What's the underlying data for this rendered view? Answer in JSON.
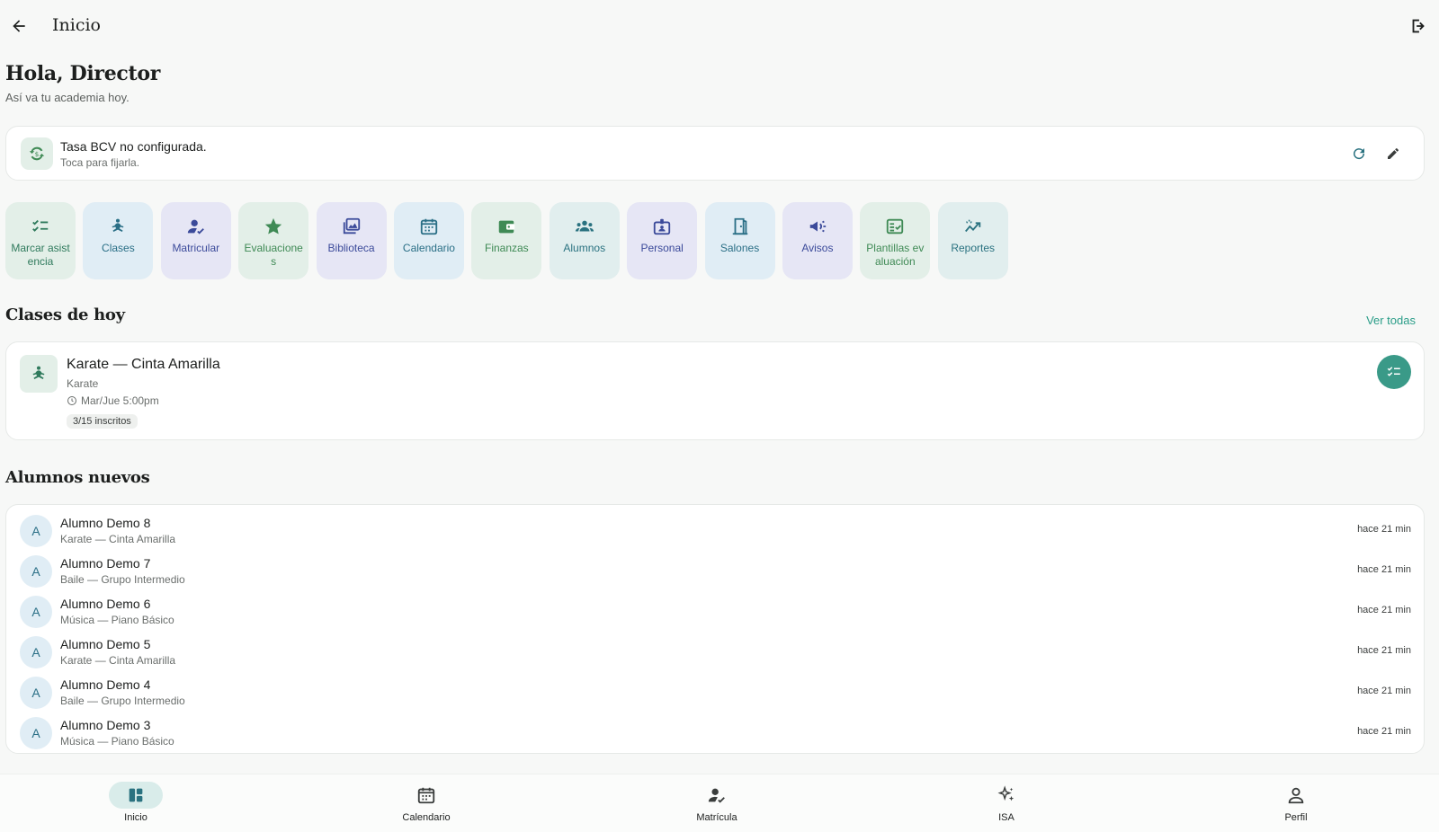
{
  "topbar": {
    "title": "Inicio"
  },
  "greeting": {
    "title": "Hola, Director",
    "subtitle": "Así va tu academia hoy."
  },
  "rate": {
    "title": "Tasa BCV no configurada.",
    "subtitle": "Toca para fijarla."
  },
  "quick_actions": [
    {
      "label": "Marcar asistencia",
      "icon": "checklist-icon",
      "bg": "#e3efe8",
      "color": "#2f7a5c"
    },
    {
      "label": "Clases",
      "icon": "meditation-icon",
      "bg": "#e0edf5",
      "color": "#2a6f86"
    },
    {
      "label": "Matricular",
      "icon": "person-check-icon",
      "bg": "#e6e6f5",
      "color": "#3b4a9a"
    },
    {
      "label": "Evaluaciones",
      "icon": "star-icon",
      "bg": "#e3efe8",
      "color": "#3f8a55"
    },
    {
      "label": "Biblioteca",
      "icon": "photo-library-icon",
      "bg": "#e6e6f5",
      "color": "#3b4a9a"
    },
    {
      "label": "Calendario",
      "icon": "calendar-icon",
      "bg": "#e0edf5",
      "color": "#2a6f86"
    },
    {
      "label": "Finanzas",
      "icon": "wallet-icon",
      "bg": "#e3efe8",
      "color": "#3f8a55"
    },
    {
      "label": "Alumnos",
      "icon": "groups-icon",
      "bg": "#e1eeee",
      "color": "#2a7280"
    },
    {
      "label": "Personal",
      "icon": "badge-icon",
      "bg": "#e6e6f5",
      "color": "#3b4a9a"
    },
    {
      "label": "Salones",
      "icon": "door-icon",
      "bg": "#e0edf5",
      "color": "#2a6f86"
    },
    {
      "label": "Avisos",
      "icon": "megaphone-icon",
      "bg": "#e6e6f5",
      "color": "#3b4a9a"
    },
    {
      "label": "Plantillas evaluación",
      "icon": "fact-check-icon",
      "bg": "#e3efe8",
      "color": "#3f8a55"
    },
    {
      "label": "Reportes",
      "icon": "trending-icon",
      "bg": "#e1eeee",
      "color": "#2a7280"
    }
  ],
  "classes_today": {
    "title": "Clases de hoy",
    "see_all": "Ver todas",
    "items": [
      {
        "name": "Karate — Cinta Amarilla",
        "discipline": "Karate",
        "schedule": "Mar/Jue 5:00pm",
        "enrolled": "3/15 inscritos"
      }
    ]
  },
  "new_students": {
    "title": "Alumnos nuevos",
    "items": [
      {
        "initial": "A",
        "name": "Alumno Demo 8",
        "class": "Karate — Cinta Amarilla",
        "time": "hace 21 min"
      },
      {
        "initial": "A",
        "name": "Alumno Demo 7",
        "class": "Baile — Grupo Intermedio",
        "time": "hace 21 min"
      },
      {
        "initial": "A",
        "name": "Alumno Demo 6",
        "class": "Música — Piano Básico",
        "time": "hace 21 min"
      },
      {
        "initial": "A",
        "name": "Alumno Demo 5",
        "class": "Karate — Cinta Amarilla",
        "time": "hace 21 min"
      },
      {
        "initial": "A",
        "name": "Alumno Demo 4",
        "class": "Baile — Grupo Intermedio",
        "time": "hace 21 min"
      },
      {
        "initial": "A",
        "name": "Alumno Demo 3",
        "class": "Música — Piano Básico",
        "time": "hace 21 min"
      }
    ]
  },
  "bottom_nav": [
    {
      "label": "Inicio",
      "icon": "dashboard-icon",
      "active": true
    },
    {
      "label": "Calendario",
      "icon": "calendar-icon",
      "active": false
    },
    {
      "label": "Matrícula",
      "icon": "person-check-icon",
      "active": false
    },
    {
      "label": "ISA",
      "icon": "sparkle-icon",
      "active": false
    },
    {
      "label": "Perfil",
      "icon": "person-icon",
      "active": false
    }
  ],
  "colors": {
    "accent": "#3a9a88",
    "link": "#2a9d88",
    "background": "#f7f8f7"
  }
}
